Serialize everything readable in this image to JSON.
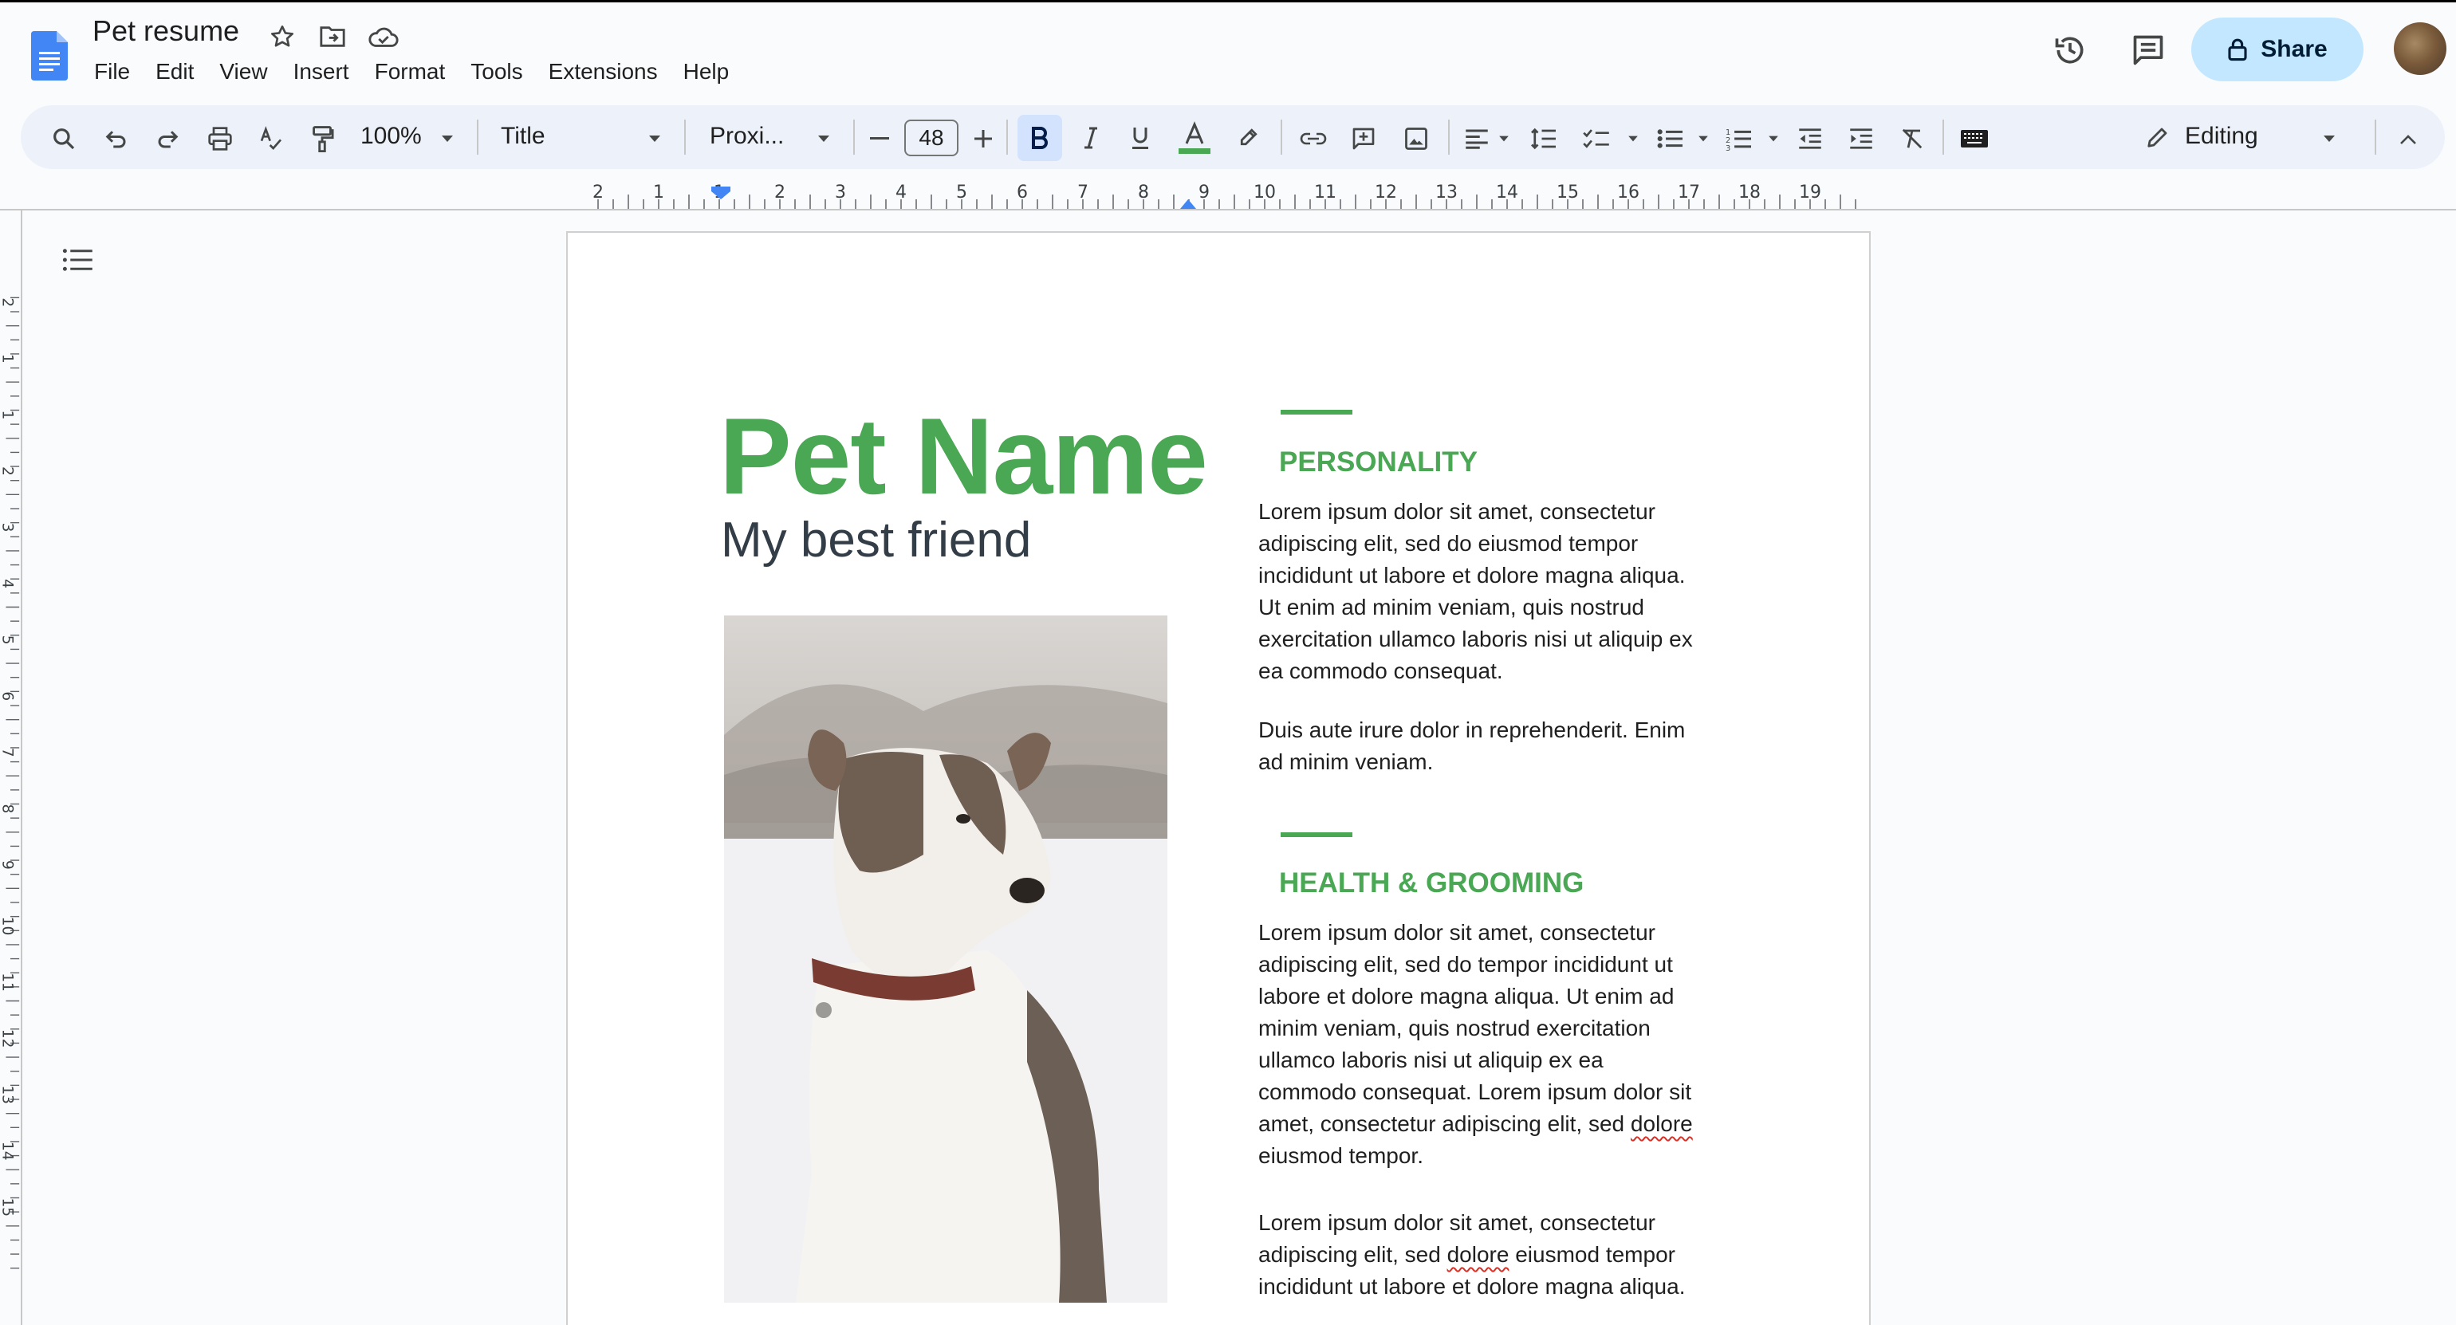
{
  "app": {
    "title": "Pet resume",
    "menu": [
      "File",
      "Edit",
      "View",
      "Insert",
      "Format",
      "Tools",
      "Extensions",
      "Help"
    ],
    "share_label": "Share",
    "accent": "#c2e7ff"
  },
  "toolbar": {
    "zoom": "100%",
    "style": "Title",
    "font": "Proxi...",
    "font_size": "48",
    "mode": "Editing",
    "icons": [
      "search-icon",
      "undo-icon",
      "redo-icon",
      "print-icon",
      "spellcheck-icon",
      "paint-format-icon",
      "bold-icon",
      "italic-icon",
      "underline-icon",
      "text-color-icon",
      "highlight-icon",
      "link-icon",
      "add-comment-icon",
      "image-icon",
      "align-icon",
      "line-spacing-icon",
      "checklist-icon",
      "bullet-list-icon",
      "numbered-list-icon",
      "decrease-indent-icon",
      "increase-indent-icon",
      "clear-formatting-icon",
      "keyboard-icon",
      "pencil-icon",
      "collapse-icon"
    ]
  },
  "ruler": {
    "labels": [
      "2",
      "1",
      "1",
      "2",
      "3",
      "4",
      "5",
      "6",
      "7",
      "8",
      "9",
      "10",
      "11",
      "12",
      "13",
      "14",
      "15",
      "16",
      "17",
      "18",
      "19"
    ],
    "vlabels": [
      "2",
      "1",
      "1",
      "2",
      "3",
      "4",
      "5",
      "6",
      "7",
      "8",
      "9",
      "10",
      "11",
      "12",
      "13",
      "14",
      "15"
    ]
  },
  "document": {
    "pet_name": "Pet Name",
    "subtitle": "My best friend",
    "brand_color": "#4aa754",
    "sections": [
      {
        "heading": "PERSONALITY",
        "paragraphs": [
          [
            "Lorem ipsum dolor sit amet, consectetur",
            "adipiscing elit, sed do eiusmod tempor",
            "incididunt ut labore et dolore magna aliqua.",
            "Ut enim ad minim veniam, quis nostrud",
            "exercitation ullamco laboris nisi ut aliquip ex",
            "ea commodo consequat."
          ],
          [
            "Duis aute irure dolor in reprehenderit. Enim",
            "ad minim veniam."
          ]
        ]
      },
      {
        "heading": "HEALTH & GROOMING",
        "paragraphs": [
          [
            "Lorem ipsum dolor sit amet, consectetur",
            "adipiscing elit, sed do tempor incididunt ut",
            "labore et dolore magna aliqua. Ut enim ad",
            "minim veniam, quis nostrud exercitation",
            "ullamco laboris nisi ut aliquip ex ea",
            "commodo consequat. Lorem ipsum dolor sit",
            "amet, consectetur adipiscing elit, sed dolore",
            "eiusmod tempor."
          ],
          [
            "Lorem ipsum dolor sit amet, consectetur",
            "adipiscing elit, sed dolore eiusmod tempor",
            "incididunt ut labore et dolore magna aliqua."
          ]
        ]
      }
    ]
  }
}
